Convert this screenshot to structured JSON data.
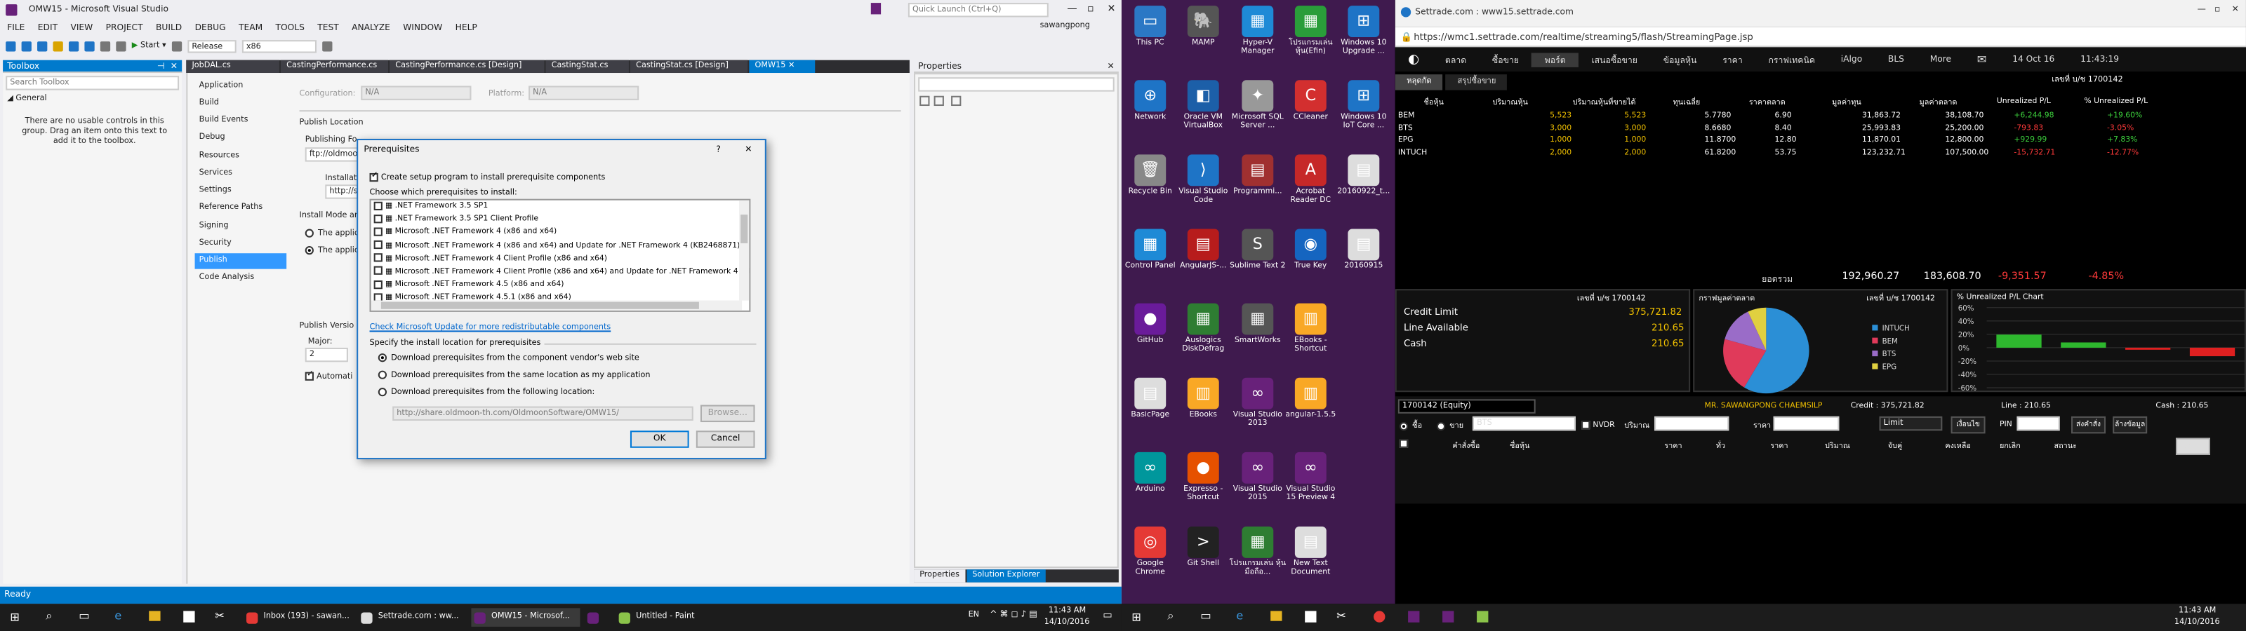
{
  "vs": {
    "title": "OMW15 - Microsoft Visual Studio",
    "quick_launch": "Quick Launch (Ctrl+Q)",
    "user": "sawangpong",
    "menu": [
      "FILE",
      "EDIT",
      "VIEW",
      "PROJECT",
      "BUILD",
      "DEBUG",
      "TEAM",
      "TOOLS",
      "TEST",
      "ANALYZE",
      "WINDOW",
      "HELP"
    ],
    "toolbar": {
      "start": "Start",
      "config": "Release",
      "platform": "x86"
    },
    "toolbox": {
      "header": "Toolbox",
      "search": "Search Toolbox",
      "group": "General",
      "empty_text": "There are no usable controls in this group. Drag an item onto this text to add it to the toolbox."
    },
    "tabs": [
      "JobDAL.cs",
      "CastingPerformance.cs",
      "CastingPerformance.cs [Design]",
      "CastingStat.cs",
      "CastingStat.cs [Design]",
      "OMW15"
    ],
    "properties_header": "Properties",
    "sidebar": [
      "Application",
      "Build",
      "Build Events",
      "Debug",
      "Resources",
      "Services",
      "Settings",
      "Reference Paths",
      "Signing",
      "Security",
      "Publish",
      "Code Analysis"
    ],
    "publish": {
      "configuration_label": "Configuration:",
      "configuration_value": "N/A",
      "platform_label": "Platform:",
      "platform_value": "N/A",
      "publish_location": "Publish Location",
      "publishing_folder": "Publishing Fo",
      "folder_value": "ftp://oldmoo",
      "installation": "Installati",
      "install_value": "http://sh",
      "install_mode": "Install Mode an",
      "opt1": "The applic",
      "opt2": "The applic",
      "publish_version": "Publish Versio",
      "major_label": "Major:",
      "major_value": "2",
      "auto": "Automati"
    },
    "status": "Ready",
    "bottom_tabs": [
      "Properties",
      "Solution Explorer"
    ]
  },
  "dialog": {
    "title": "Prerequisites",
    "help": "?",
    "close": "✕",
    "create_setup": "Create setup program to install prerequisite components",
    "choose_label": "Choose which prerequisites to install:",
    "items": [
      ".NET Framework 3.5 SP1",
      ".NET Framework 3.5 SP1 Client Profile",
      "Microsoft .NET Framework 4 (x86 and x64)",
      "Microsoft .NET Framework 4 (x86 and x64) and Update for .NET Framework 4 (KB2468871)",
      "Microsoft .NET Framework 4 Client Profile (x86 and x64)",
      "Microsoft .NET Framework 4 Client Profile (x86 and x64) and Update for .NET Framework 4 (KB",
      "Microsoft .NET Framework 4.5 (x86 and x64)",
      "Microsoft .NET Framework 4.5.1 (x86 and x64)"
    ],
    "check_link": "Check Microsoft Update for more redistributable components",
    "location_label": "Specify the install location for prerequisites",
    "radio1": "Download prerequisites from the component vendor's web site",
    "radio2": "Download prerequisites from the same location as my application",
    "radio3": "Download prerequisites from the following location:",
    "location_value": "http://share.oldmoon-th.com/OldmoonSoftware/OMW15/",
    "browse": "Browse...",
    "ok": "OK",
    "cancel": "Cancel"
  },
  "desktop": [
    {
      "label": "This PC",
      "color": "#2b78c5",
      "glyph": "▭"
    },
    {
      "label": "MAMP",
      "color": "#555",
      "glyph": "🐘"
    },
    {
      "label": "Hyper-V Manager",
      "color": "#1e8ad6",
      "glyph": "▦"
    },
    {
      "label": "โปรแกรมเล่น หุ้น(Efin)",
      "color": "#2a9d3a",
      "glyph": "▦"
    },
    {
      "label": "Windows 10 Upgrade ...",
      "color": "#1e74c6",
      "glyph": "⊞"
    },
    {
      "label": "Network",
      "color": "#1e74c6",
      "glyph": "⊕"
    },
    {
      "label": "Oracle VM VirtualBox",
      "color": "#1c5fa8",
      "glyph": "◧"
    },
    {
      "label": "Microsoft SQL Server ...",
      "color": "#999",
      "glyph": "✦"
    },
    {
      "label": "CCleaner",
      "color": "#d32f2f",
      "glyph": "C"
    },
    {
      "label": "Windows 10 IoT Core ...",
      "color": "#1e74c6",
      "glyph": "⊞"
    },
    {
      "label": "Recycle Bin",
      "color": "#888",
      "glyph": "🗑"
    },
    {
      "label": "Visual Studio Code",
      "color": "#1e74c6",
      "glyph": "⟩"
    },
    {
      "label": "Programmi...",
      "color": "#a03030",
      "glyph": "▤"
    },
    {
      "label": "Acrobat Reader DC",
      "color": "#c62828",
      "glyph": "A"
    },
    {
      "label": "20160922_t...",
      "color": "#ddd",
      "glyph": "▤"
    },
    {
      "label": "Control Panel",
      "color": "#1e8ad6",
      "glyph": "▦"
    },
    {
      "label": "AngularJS-...",
      "color": "#b71c1c",
      "glyph": "▤"
    },
    {
      "label": "Sublime Text 2",
      "color": "#555",
      "glyph": "S"
    },
    {
      "label": "True Key",
      "color": "#1565c0",
      "glyph": "◉"
    },
    {
      "label": "20160915",
      "color": "#ddd",
      "glyph": "▤"
    },
    {
      "label": "GitHub",
      "color": "#6a1b9a",
      "glyph": "●"
    },
    {
      "label": "Auslogics DiskDefrag",
      "color": "#2e7d32",
      "glyph": "▦"
    },
    {
      "label": "SmartWorks",
      "color": "#555",
      "glyph": "▦"
    },
    {
      "label": "EBooks - Shortcut",
      "color": "#f9a825",
      "glyph": "▥"
    },
    {
      "label": "",
      "color": "transparent",
      "glyph": ""
    },
    {
      "label": "BasicPage",
      "color": "#ddd",
      "glyph": "▤"
    },
    {
      "label": "EBooks",
      "color": "#f9a825",
      "glyph": "▥"
    },
    {
      "label": "Visual Studio 2013",
      "color": "#68217a",
      "glyph": "∞"
    },
    {
      "label": "angular-1.5.5",
      "color": "#f9a825",
      "glyph": "▥"
    },
    {
      "label": "",
      "color": "transparent",
      "glyph": ""
    },
    {
      "label": "Arduino",
      "color": "#00979c",
      "glyph": "∞"
    },
    {
      "label": "Expresso - Shortcut",
      "color": "#e65100",
      "glyph": "●"
    },
    {
      "label": "Visual Studio 2015",
      "color": "#68217a",
      "glyph": "∞"
    },
    {
      "label": "Visual Studio 15 Preview 4",
      "color": "#68217a",
      "glyph": "∞"
    },
    {
      "label": "",
      "color": "transparent",
      "glyph": ""
    },
    {
      "label": "Google Chrome",
      "color": "#e53935",
      "glyph": "◎"
    },
    {
      "label": "Git Shell",
      "color": "#222",
      "glyph": ">"
    },
    {
      "label": "โปรแกรมเล่น หุ้นมือถือ...",
      "color": "#2e7d32",
      "glyph": "▦"
    },
    {
      "label": "New Text Document",
      "color": "#ddd",
      "glyph": "▤"
    }
  ],
  "chrome": {
    "tab_title": "Settrade.com : www15.settrade.com",
    "url": "https://wmc1.settrade.com/realtime/streaming5/flash/StreamingPage.jsp",
    "nav": [
      "ตลาด",
      "ซื้อขาย",
      "พอร์ต",
      "เสนอซื้อขาย",
      "ข้อมูลหุ้น",
      "ราคา",
      "กราฟเทคนิค",
      "iAlgo",
      "BLS",
      "More"
    ],
    "date": "14 Oct 16",
    "time": "11:43:19",
    "sub_tabs": [
      "หลุดกัด",
      "สรุปซื้อขาย"
    ],
    "account_label": "เลขที่ บ/ช 1700142",
    "headers": [
      "ชื่อหุ้น",
      "ปริมาณหุ้น",
      "ปริมาณหุ้นที่ขายได้",
      "ทุนเฉลี่ย",
      "ราคาตลาด",
      "มูลค่าทุน",
      "มูลค่าตลาด",
      "Unrealized P/L",
      "% Unrealized P/L"
    ],
    "rows": [
      [
        "BEM",
        "5,523",
        "5,523",
        "5.7780",
        "6.90",
        "31,863.72",
        "38,108.70",
        "+6,244.98",
        "+19.60%"
      ],
      [
        "BTS",
        "3,000",
        "3,000",
        "8.6680",
        "8.40",
        "25,993.83",
        "25,200.00",
        "-793.83",
        "-3.05%"
      ],
      [
        "EPG",
        "1,000",
        "1,000",
        "11.8700",
        "12.80",
        "11,870.01",
        "12,800.00",
        "+929.99",
        "+7.83%"
      ],
      [
        "INTUCH",
        "2,000",
        "2,000",
        "61.8200",
        "53.75",
        "123,232.71",
        "107,500.00",
        "-15,732.71",
        "-12.77%"
      ]
    ],
    "totals_label": "ยอดรวม",
    "totals": [
      "192,960.27",
      "183,608.70",
      "-9,351.57",
      "-4.85%"
    ],
    "credit": {
      "account": "เลขที่ บ/ช 1700142",
      "credit_limit_label": "Credit Limit",
      "credit_limit": "375,721.82",
      "line_label": "Line Available",
      "line": "210.65",
      "cash_label": "Cash",
      "cash": "210.65"
    },
    "pie": {
      "title": "กราฟมูลค่าตลาด",
      "account": "เลขที่ บ/ช 1700142",
      "legend": [
        "INTUCH",
        "BEM",
        "BTS",
        "EPG"
      ],
      "colors": [
        "#2b8fd6",
        "#e03a5a",
        "#9a6cc8",
        "#e0d040"
      ],
      "values": [
        107500,
        38108.7,
        25200,
        12800
      ]
    },
    "plchart": {
      "title": "% Unrealized P/L Chart",
      "ticks": [
        "60%",
        "40%",
        "20%",
        "0%",
        "-20%",
        "-40%",
        "-60%"
      ],
      "values": [
        19.6,
        7.83,
        -3.05,
        -12.77
      ]
    },
    "order": {
      "account": "1700142 (Equity)",
      "name": "MR. SAWANGPONG CHAEMSILP",
      "credit": "Credit : 375,721.82",
      "line": "Line : 210.65",
      "cash": "Cash : 210.65",
      "buy": "ซื้อ",
      "sell": "ขาย",
      "symbol": "BTS",
      "nvdr": "NVDR",
      "volume": "ปริมาณ",
      "price": "ราคา",
      "type": "Limit",
      "condition": "เงื่อนไข",
      "pin": "PIN",
      "send": "ส่งคำสั่ง",
      "clear": "ล้างข้อมูล"
    },
    "order_cols": [
      "คำสั่งซื้อ",
      "ชื่อหุ้น",
      "ราคา",
      "ทั่ว",
      "ราคา",
      "ปริมาณ",
      "จับคู่",
      "คงเหลือ",
      "ยกเลิก",
      "สถานะ"
    ],
    "cancel_btn": "ยกเลิก"
  },
  "taskbar_left": {
    "items": [
      "Inbox (193) - sawan...",
      "Settrade.com : ww...",
      "OMW15 - Microsof...",
      "",
      "Untitled - Paint"
    ],
    "lang": "EN",
    "time": "11:43 AM",
    "date": "14/10/2016"
  },
  "taskbar_right": {
    "time": "11:43 AM",
    "date": "14/10/2016"
  }
}
